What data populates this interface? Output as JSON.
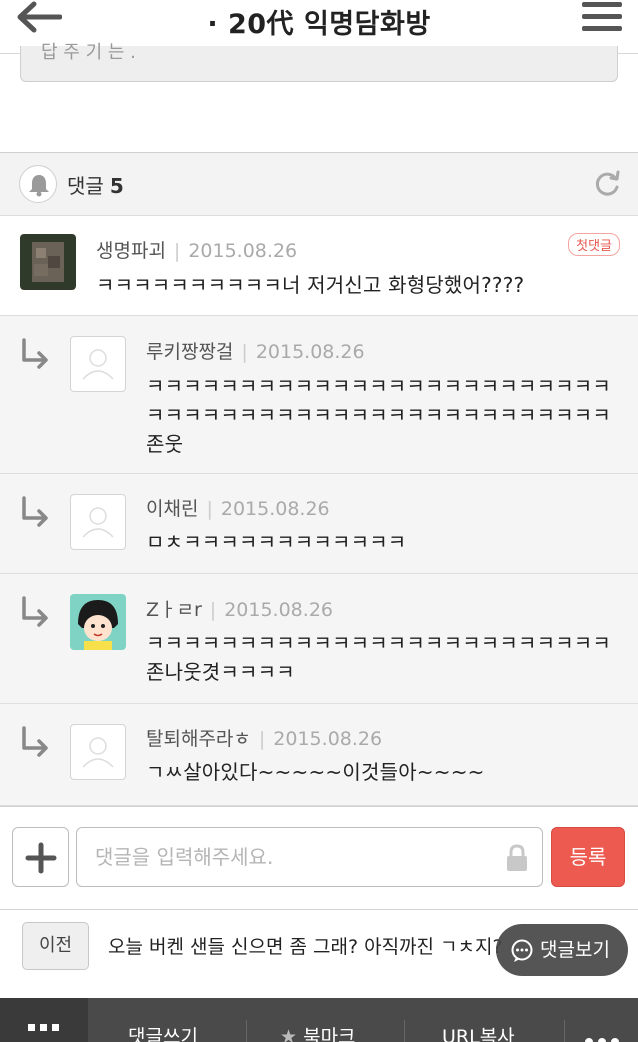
{
  "header": {
    "title": "· 20代 익명담화방"
  },
  "previous_box": {
    "text": "답 주 기 는 ."
  },
  "comments_section": {
    "label": "댓글",
    "count": "5",
    "first_badge": "첫댓글",
    "items": [
      {
        "author": "생명파괴",
        "date": "2015.08.26",
        "body": "ㅋㅋㅋㅋㅋㅋㅋㅋㅋㅋ너 저거신고 화형당했어????"
      },
      {
        "author": "루키짱짱걸",
        "date": "2015.08.26",
        "body_lines": [
          "ㅋㅋㅋㅋㅋㅋㅋㅋㅋㅋㅋㅋㅋㅋㅋㅋㅋㅋㅋㅋㅋㅋㅋㅋㅋ",
          "ㅋㅋㅋㅋㅋㅋㅋㅋㅋㅋㅋㅋㅋㅋㅋㅋㅋㅋㅋㅋㅋㅋㅋㅋㅋ",
          "존웃"
        ]
      },
      {
        "author": "이채린",
        "date": "2015.08.26",
        "body": "ㅁㅊㅋㅋㅋㅋㅋㅋㅋㅋㅋㅋㅋㅋ"
      },
      {
        "author": "Zㅏㄹr",
        "date": "2015.08.26",
        "body_lines": [
          "ㅋㅋㅋㅋㅋㅋㅋㅋㅋㅋㅋㅋㅋㅋㅋㅋㅋㅋㅋㅋㅋㅋㅋㅋㅋ",
          "존나웃겻ㅋㅋㅋㅋ"
        ]
      },
      {
        "author": "탈퇴해주라ㅎ",
        "date": "2015.08.26",
        "body": "ㄱㅆ살아있다~~~~~이것들아~~~~"
      }
    ]
  },
  "comment_input": {
    "placeholder": "댓글을 입력해주세요.",
    "value": "",
    "submit_label": "등록"
  },
  "navigation": {
    "prev_label": "이전",
    "prev_title": "오늘 버켄 샌들 신으면 좀 그래? 아직까진 ㄱㅊ지?",
    "view_comments_label": "댓글보기"
  },
  "bottom_bar": {
    "items": [
      "댓글쓰기",
      "북마크",
      "URL복사"
    ]
  },
  "colors": {
    "accent_red": "#ec5a50",
    "bottom_bar": "#4a4a4a"
  },
  "icons": [
    "back-arrow-icon",
    "menu-icon",
    "bell-icon",
    "refresh-icon",
    "reply-arrow-icon",
    "plus-icon",
    "lock-icon",
    "chat-bubble-icon",
    "grid-icon",
    "star-icon",
    "more-icon"
  ]
}
